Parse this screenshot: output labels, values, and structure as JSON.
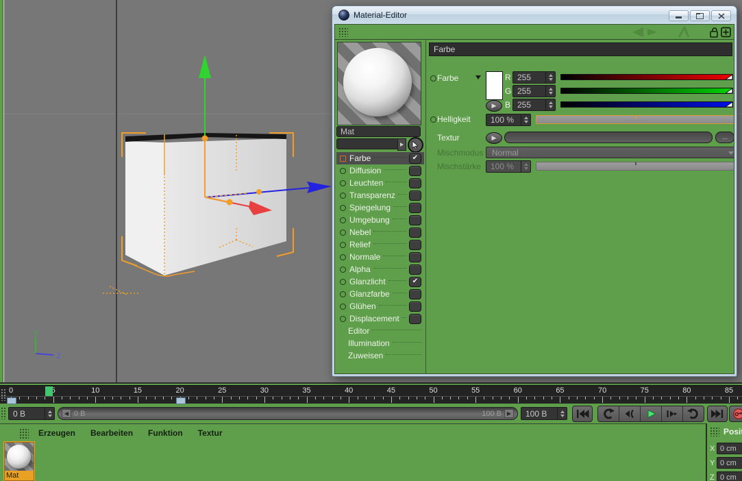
{
  "window": {
    "title": "Material-Editor",
    "buttons": [
      "minimize",
      "maximize",
      "close"
    ]
  },
  "editor": {
    "material_name": "Mat",
    "channels": [
      {
        "label": "Farbe",
        "checked": true,
        "selected": true,
        "indicator": "orange"
      },
      {
        "label": "Diffusion",
        "checked": false
      },
      {
        "label": "Leuchten",
        "checked": false
      },
      {
        "label": "Transparenz",
        "checked": false
      },
      {
        "label": "Spiegelung",
        "checked": false
      },
      {
        "label": "Umgebung",
        "checked": false
      },
      {
        "label": "Nebel",
        "checked": false
      },
      {
        "label": "Relief",
        "checked": false
      },
      {
        "label": "Normale",
        "checked": false
      },
      {
        "label": "Alpha",
        "checked": false
      },
      {
        "label": "Glanzlicht",
        "checked": true
      },
      {
        "label": "Glanzfarbe",
        "checked": false
      },
      {
        "label": "Glühen",
        "checked": false
      },
      {
        "label": "Displacement",
        "checked": false
      }
    ],
    "pages": [
      "Editor",
      "Illumination",
      "Zuweisen"
    ],
    "color_panel": {
      "header": "Farbe",
      "color_row_label": "Farbe",
      "rgb_rows": [
        {
          "label": "R",
          "value": "255",
          "color": "#f00000"
        },
        {
          "label": "G",
          "value": "255",
          "color": "#00d400"
        },
        {
          "label": "B",
          "value": "255",
          "color": "#0010e8"
        }
      ],
      "brightness_label": "Helligkeit",
      "brightness_value": "100 %",
      "texture_label": "Textur",
      "texture_browse": "...",
      "mix_mode_label": "Mischmodus",
      "mix_mode_value": "Normal",
      "mix_strength_label": "Mischstärke",
      "mix_strength_value": "100 %"
    }
  },
  "viewport": {
    "axis_gizmo": {
      "y": "Y",
      "z": "Z"
    },
    "colors": {
      "background": "#777777",
      "selection_orange": "#f29e2a",
      "axis_x": "#e84040",
      "axis_y": "#2fd42f",
      "axis_z": "#2222e0"
    }
  },
  "timeline": {
    "frame_labels": [
      "0",
      "5",
      "10",
      "15",
      "20",
      "25",
      "30",
      "35",
      "40",
      "45",
      "50",
      "55",
      "60",
      "65",
      "70",
      "75",
      "80",
      "85"
    ],
    "label_step": 5,
    "max_frame": 86,
    "playhead_frame": 5,
    "keyframe_markers": [
      0,
      20
    ],
    "current_frame": "0 B",
    "range_start": "0 B",
    "range_end": "100 B",
    "end_frame": "100 B"
  },
  "transport": {
    "buttons": [
      "go-to-start",
      "previous-key",
      "previous-frame",
      "play-forward",
      "next-frame",
      "next-key",
      "go-to-end",
      "record-keyframes"
    ]
  },
  "menu_bar": {
    "items": [
      "Erzeugen",
      "Bearbeiten",
      "Funktion",
      "Textur"
    ]
  },
  "materials_shelf": {
    "items": [
      {
        "name": "Mat",
        "selected": true
      }
    ]
  },
  "coordinates_panel": {
    "title": "Posit",
    "axes": [
      {
        "label": "X",
        "value": "0 cm"
      },
      {
        "label": "Y",
        "value": "0 cm"
      },
      {
        "label": "Z",
        "value": "0 cm"
      }
    ]
  }
}
